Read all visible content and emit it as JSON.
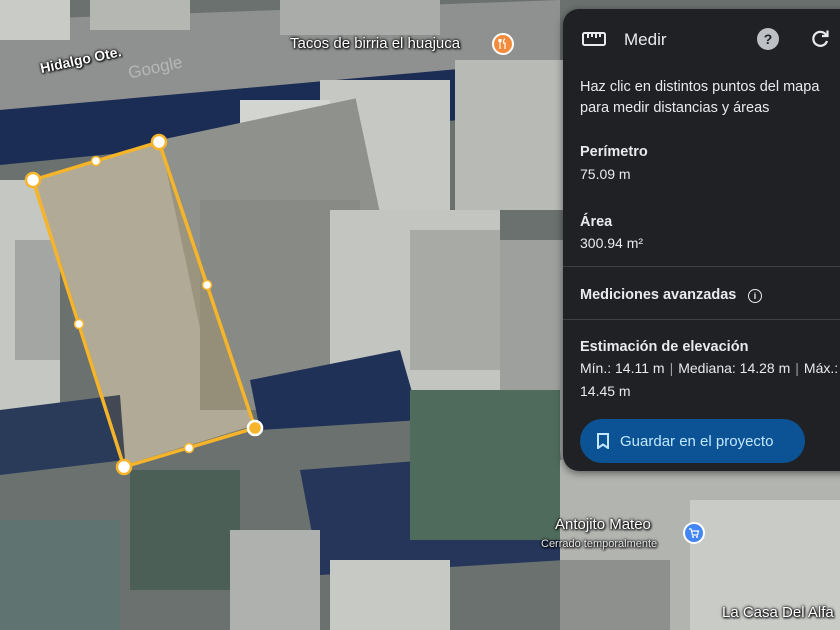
{
  "map": {
    "street_label": "Hidalgo Ote.",
    "watermark": "Google",
    "places": [
      {
        "name": "Tacos de birria el huajuca",
        "icon": "restaurant-icon",
        "color": "#f28b3c"
      },
      {
        "name": "Antojito Mateo",
        "status": "Cerrado temporalmente",
        "icon": "shopping-cart-icon",
        "color": "#4285f4"
      },
      {
        "name": "La Casa Del Alfa"
      }
    ],
    "measure_outline_color": "#f5b42a"
  },
  "panel": {
    "title": "Medir",
    "header_icon": "ruler-icon",
    "help_icon": "help-icon",
    "refresh_icon": "refresh-icon",
    "instructions": "Haz clic en distintos puntos del mapa para medir distancias y áreas",
    "perimeter": {
      "label": "Perímetro",
      "value": "75.09 m"
    },
    "area": {
      "label": "Área",
      "value": "300.94 m²"
    },
    "advanced": {
      "label": "Mediciones avanzadas"
    },
    "elevation": {
      "label": "Estimación de elevación",
      "min": "Mín.: 14.11 m",
      "median": "Mediana: 14.28 m",
      "max_prefix": "Máx.:",
      "max_value": "14.45 m"
    },
    "save_button": {
      "label": "Guardar en el proyecto",
      "icon": "bookmark-icon"
    },
    "colors": {
      "background": "#202124",
      "button": "#0b5394",
      "button_text": "#c2e7ff"
    }
  }
}
